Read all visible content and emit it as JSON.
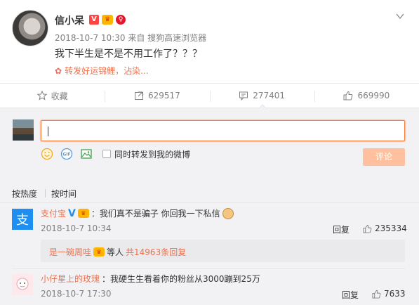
{
  "post": {
    "username": "信小呆",
    "badge_v": "V",
    "badge_crown": "♛",
    "badge_red": "♀",
    "time": "2018-10-7 10:30",
    "source_prefix": "来自",
    "source": "搜狗高速浏览器",
    "content": "我下半生是不是不用工作了？？？",
    "repost_link": "转发好运锦鲤，沾染..."
  },
  "actions": {
    "favorite": "收藏",
    "repost": "629517",
    "comment": "277401",
    "like": "669990"
  },
  "composer": {
    "repost_label": "同时转发到我的微博",
    "submit": "评论"
  },
  "sort": {
    "hot": "按热度",
    "time": "按时间"
  },
  "comments": [
    {
      "name": "支付宝",
      "text": "：我们真不是骗子 你回我一下私信",
      "time": "2018-10-7 10:34",
      "reply": "回复",
      "likes": "235334",
      "sub": {
        "name": "是一碗周哇",
        "middle": "等人",
        "link": "共14963条回复"
      }
    },
    {
      "name": "小仔星上的玫瑰",
      "text": "：我硬生生看着你的粉丝从3000蹦到25万",
      "time": "2018-10-7 17:30",
      "reply": "回复",
      "likes": "7633"
    }
  ],
  "colors": {
    "accent": "#eb7350",
    "submit_disabled": "#ffc09f",
    "alipay_blue": "#1e8ff0"
  }
}
